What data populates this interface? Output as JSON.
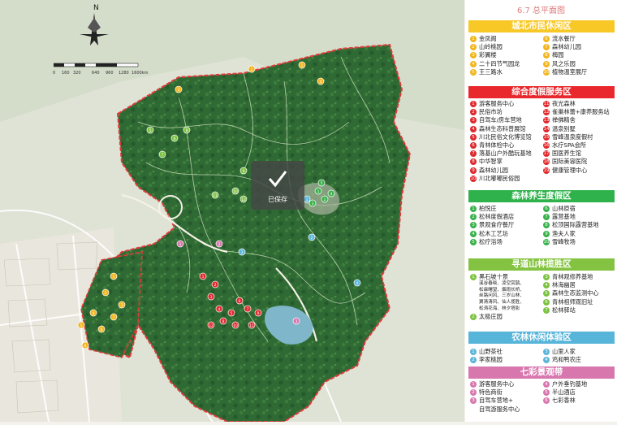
{
  "title": "6.7 总平面图",
  "map": {
    "north_label": "N",
    "scale_labels": [
      "0",
      "160",
      "320",
      "640",
      "960",
      "1280",
      "1600km"
    ],
    "toast_text": "已保存",
    "toast_icon": "check-icon"
  },
  "colors": {
    "yellow": "#f2b51d",
    "red": "#e0282b",
    "green": "#39b14a",
    "lightgreen": "#7cc241",
    "cyan": "#5bb5d8",
    "pink": "#d877ae",
    "boundary": "#e23a3a",
    "forest": "#2e6b33"
  },
  "sections": [
    {
      "name": "城北市民休闲区",
      "color": "#f7c826",
      "marker": "#f2b51d",
      "left": [
        {
          "n": "1",
          "t": "金凤阁"
        },
        {
          "n": "2",
          "t": "山岭桃园"
        },
        {
          "n": "3",
          "t": "彩翼楼"
        },
        {
          "n": "4",
          "t": "二十四节气园龙"
        },
        {
          "n": "5",
          "t": "王三路水"
        }
      ],
      "right": [
        {
          "n": "6",
          "t": "流水餐厅"
        },
        {
          "n": "7",
          "t": "森林幼儿园"
        },
        {
          "n": "8",
          "t": "梅园"
        },
        {
          "n": "9",
          "t": "风之乐园"
        },
        {
          "n": "10",
          "t": "植物温室展厅"
        }
      ]
    },
    {
      "name": "综合度假服务区",
      "color": "#e8282d",
      "marker": "#e0282b",
      "left": [
        {
          "n": "1",
          "t": "游客服务中心"
        },
        {
          "n": "2",
          "t": "民俗市坊"
        },
        {
          "n": "3",
          "t": "自驾车/房车营地"
        },
        {
          "n": "4",
          "t": "森林生态科普展馆"
        },
        {
          "n": "5",
          "t": "川北民俗文化博览馆"
        },
        {
          "n": "6",
          "t": "青林体检中心"
        },
        {
          "n": "7",
          "t": "落基山户外酷玩基地"
        },
        {
          "n": "8",
          "t": "中华智掌"
        },
        {
          "n": "9",
          "t": "森林幼儿园"
        },
        {
          "n": "10",
          "t": "川北嘟嘟民俗园"
        }
      ],
      "right": [
        {
          "n": "11",
          "t": "夜光森林"
        },
        {
          "n": "12",
          "t": "雀巢林蕾+康养服务站"
        },
        {
          "n": "13",
          "t": "禅佛精舍"
        },
        {
          "n": "14",
          "t": "温泉别墅"
        },
        {
          "n": "15",
          "t": "雪峰温泉度假村"
        },
        {
          "n": "16",
          "t": "水疗SPA会所"
        },
        {
          "n": "17",
          "t": "国医养生馆"
        },
        {
          "n": "18",
          "t": "国际美容医院"
        },
        {
          "n": "19",
          "t": "健康管理中心"
        }
      ]
    },
    {
      "name": "森林养生度假区",
      "color": "#2fb24b",
      "marker": "#39b14a",
      "left": [
        {
          "n": "1",
          "t": "柏悦庄"
        },
        {
          "n": "2",
          "t": "松林度假酒店"
        },
        {
          "n": "3",
          "t": "景观食疗餐厅"
        },
        {
          "n": "4",
          "t": "松木工艺坊"
        },
        {
          "n": "5",
          "t": "松疗浴场"
        }
      ],
      "right": [
        {
          "n": "6",
          "t": "山林原宿"
        },
        {
          "n": "7",
          "t": "露营基地"
        },
        {
          "n": "8",
          "t": "松顶国际露营基地"
        },
        {
          "n": "9",
          "t": "渔夫人家"
        },
        {
          "n": "10",
          "t": "雪峰牧场"
        }
      ]
    },
    {
      "name": "寻道山林揽胜区",
      "color": "#84c341",
      "marker": "#7cc241",
      "left": [
        {
          "n": "1",
          "t": "黑石坡十景"
        },
        {
          "n": "2",
          "t": "太极庄园"
        }
      ],
      "sub": [
        "溪谷春晓、凌空赏鹊、",
        "松霖曙望、烟雨长桥、",
        "丝路问风、三岁山林、",
        "翼清清风、仙人揽胜、",
        "松涛花海、林夕塔影"
      ],
      "right": [
        {
          "n": "3",
          "t": "青林观修养基地"
        },
        {
          "n": "4",
          "t": "林海幽居"
        },
        {
          "n": "5",
          "t": "森林生态监测中心"
        },
        {
          "n": "6",
          "t": "青林祖师观旧址"
        },
        {
          "n": "7",
          "t": "松林驿站"
        }
      ]
    },
    {
      "name": "农林休闲体验区",
      "color": "#58b5da",
      "marker": "#5bb5d8",
      "left": [
        {
          "n": "1",
          "t": "山野茶社"
        },
        {
          "n": "2",
          "t": "李家桃园"
        }
      ],
      "right": [
        {
          "n": "3",
          "t": "山里人家"
        },
        {
          "n": "4",
          "t": "鸡和鸭农庄"
        }
      ]
    },
    {
      "name": "七彩景观带",
      "color": "#d877ae",
      "marker": "#d877ae",
      "left": [
        {
          "n": "1",
          "t": "游客服务中心"
        },
        {
          "n": "2",
          "t": "特色商街"
        },
        {
          "n": "3",
          "t": "自驾车营地+"
        }
      ],
      "extra": "自驾游服务中心",
      "right": [
        {
          "n": "4",
          "t": "户外垂钓基地"
        },
        {
          "n": "5",
          "t": "半山酒店"
        },
        {
          "n": "6",
          "t": "七彩香林"
        }
      ]
    }
  ]
}
